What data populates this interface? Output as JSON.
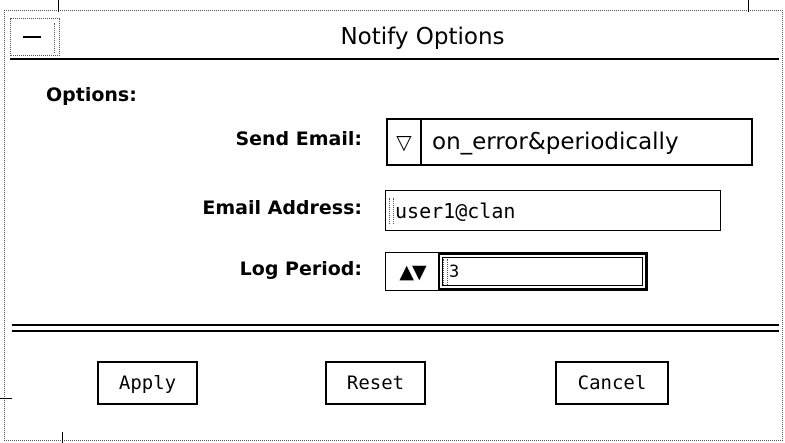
{
  "window": {
    "title": "Notify Options"
  },
  "form": {
    "section_label": "Options:",
    "send_email": {
      "label": "Send Email:",
      "value": "on_error&periodically",
      "arrow": "▽"
    },
    "email_address": {
      "label": "Email Address:",
      "value": "user1@clan"
    },
    "log_period": {
      "label": "Log Period:",
      "value": "3",
      "arrows": "▲▼"
    }
  },
  "buttons": {
    "apply": "Apply",
    "reset": "Reset",
    "cancel": "Cancel"
  }
}
